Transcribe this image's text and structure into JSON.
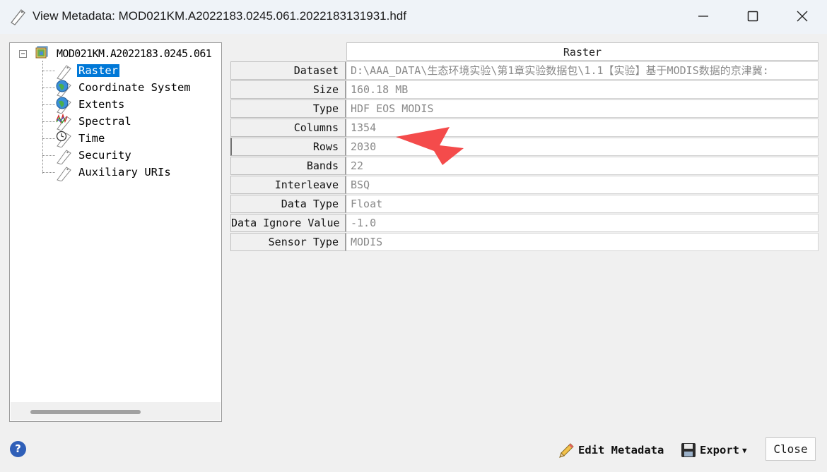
{
  "window": {
    "title": "View Metadata: MOD021KM.A2022183.0245.061.2022183131931.hdf",
    "min_icon": "minimize-icon",
    "max_icon": "maximize-icon",
    "close_icon": "close-icon"
  },
  "tree": {
    "root_label": "MOD021KM.A2022183.0245.061",
    "toggle": "−",
    "items": [
      {
        "label": "Raster",
        "icon": "tag-icon",
        "selected": true
      },
      {
        "label": "Coordinate System",
        "icon": "globe-tag-icon"
      },
      {
        "label": "Extents",
        "icon": "globe-tag-icon"
      },
      {
        "label": "Spectral",
        "icon": "spectral-tag-icon"
      },
      {
        "label": "Time",
        "icon": "clock-tag-icon"
      },
      {
        "label": "Security",
        "icon": "tag-icon"
      },
      {
        "label": "Auxiliary URIs",
        "icon": "tag-icon"
      }
    ]
  },
  "grid": {
    "header": "Raster",
    "rows": [
      {
        "label": "Dataset",
        "value": "D:\\AAA_DATA\\生态环境实验\\第1章实验数据包\\1.1【实验】基于MODIS数据的京津冀:"
      },
      {
        "label": "Size",
        "value": "160.18 MB"
      },
      {
        "label": "Type",
        "value": "HDF EOS MODIS"
      },
      {
        "label": "Columns",
        "value": "1354"
      },
      {
        "label": "Rows",
        "value": "2030"
      },
      {
        "label": "Bands",
        "value": "22"
      },
      {
        "label": "Interleave",
        "value": "BSQ"
      },
      {
        "label": "Data Type",
        "value": "Float"
      },
      {
        "label": "Data Ignore Value",
        "value": "-1.0"
      },
      {
        "label": "Sensor Type",
        "value": "MODIS"
      }
    ]
  },
  "footer": {
    "help": "?",
    "edit_label": "Edit Metadata",
    "export_label": "Export",
    "close_label": "Close"
  },
  "colors": {
    "selection": "#0078d7",
    "annotation_arrow": "#f44b4b",
    "help": "#2f5fb8"
  }
}
